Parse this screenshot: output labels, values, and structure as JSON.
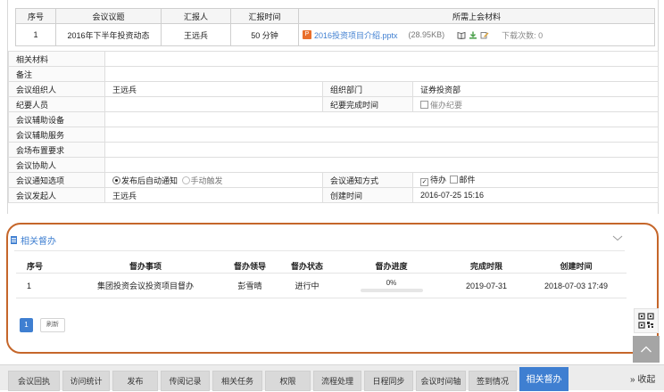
{
  "agenda": {
    "headers": [
      "序号",
      "会议议题",
      "汇报人",
      "汇报时间",
      "所需上会材料"
    ],
    "row": {
      "index": "1",
      "topic": "2016年下半年投资动态",
      "reporter": "王远兵",
      "duration": "50 分钟",
      "material_name": "2016投资项目介绍.pptx",
      "material_size": "(28.95KB)",
      "download_count": "下载次数: 0"
    }
  },
  "info": {
    "related_materials_label": "相关材料",
    "remark_label": "备注",
    "organizer_label": "会议组织人",
    "organizer_value": "王远兵",
    "org_dept_label": "组织部门",
    "org_dept_value": "证券投资部",
    "minutes_taker_label": "纪要人员",
    "minutes_due_label": "纪要完成时间",
    "urge_minutes_label": "催办纪要",
    "aux_equipment_label": "会议辅助设备",
    "aux_service_label": "会议辅助服务",
    "venue_req_label": "会场布置要求",
    "assistant_label": "会议协助人",
    "notify_option_label": "会议通知选项",
    "notify_auto_label": "发布后自动通知",
    "notify_manual_label": "手动触发",
    "notify_method_label": "会议通知方式",
    "notify_todo_label": "待办",
    "notify_mail_label": "邮件",
    "initiator_label": "会议发起人",
    "initiator_value": "王远兵",
    "created_label": "创建时间",
    "created_value": "2016-07-25 15:16"
  },
  "supervision": {
    "title": "相关督办",
    "headers": [
      "序号",
      "督办事项",
      "督办领导",
      "督办状态",
      "督办进度",
      "完成时限",
      "创建时间"
    ],
    "rows": [
      {
        "index": "1",
        "item": "集团投资会议投资项目督办",
        "leader": "彭雪晴",
        "status": "进行中",
        "progress_text": "0%",
        "progress": 0,
        "deadline": "2019-07-31",
        "created": "2018-07-03 17:49"
      }
    ],
    "pager": {
      "current_page": "1",
      "refresh_label": "刷新"
    }
  },
  "tabs": [
    "会议回执",
    "访问统计",
    "发布",
    "传阅记录",
    "相关任务",
    "权限",
    "流程处理",
    "日程同步",
    "会议时间轴",
    "签到情况",
    "相关督办"
  ],
  "active_tab": "相关督办",
  "collapse_label": "收起",
  "colors": {
    "accent": "#3f7fd1",
    "highlight_ring": "#c5662a",
    "ppt_icon": "#e96f2c"
  }
}
